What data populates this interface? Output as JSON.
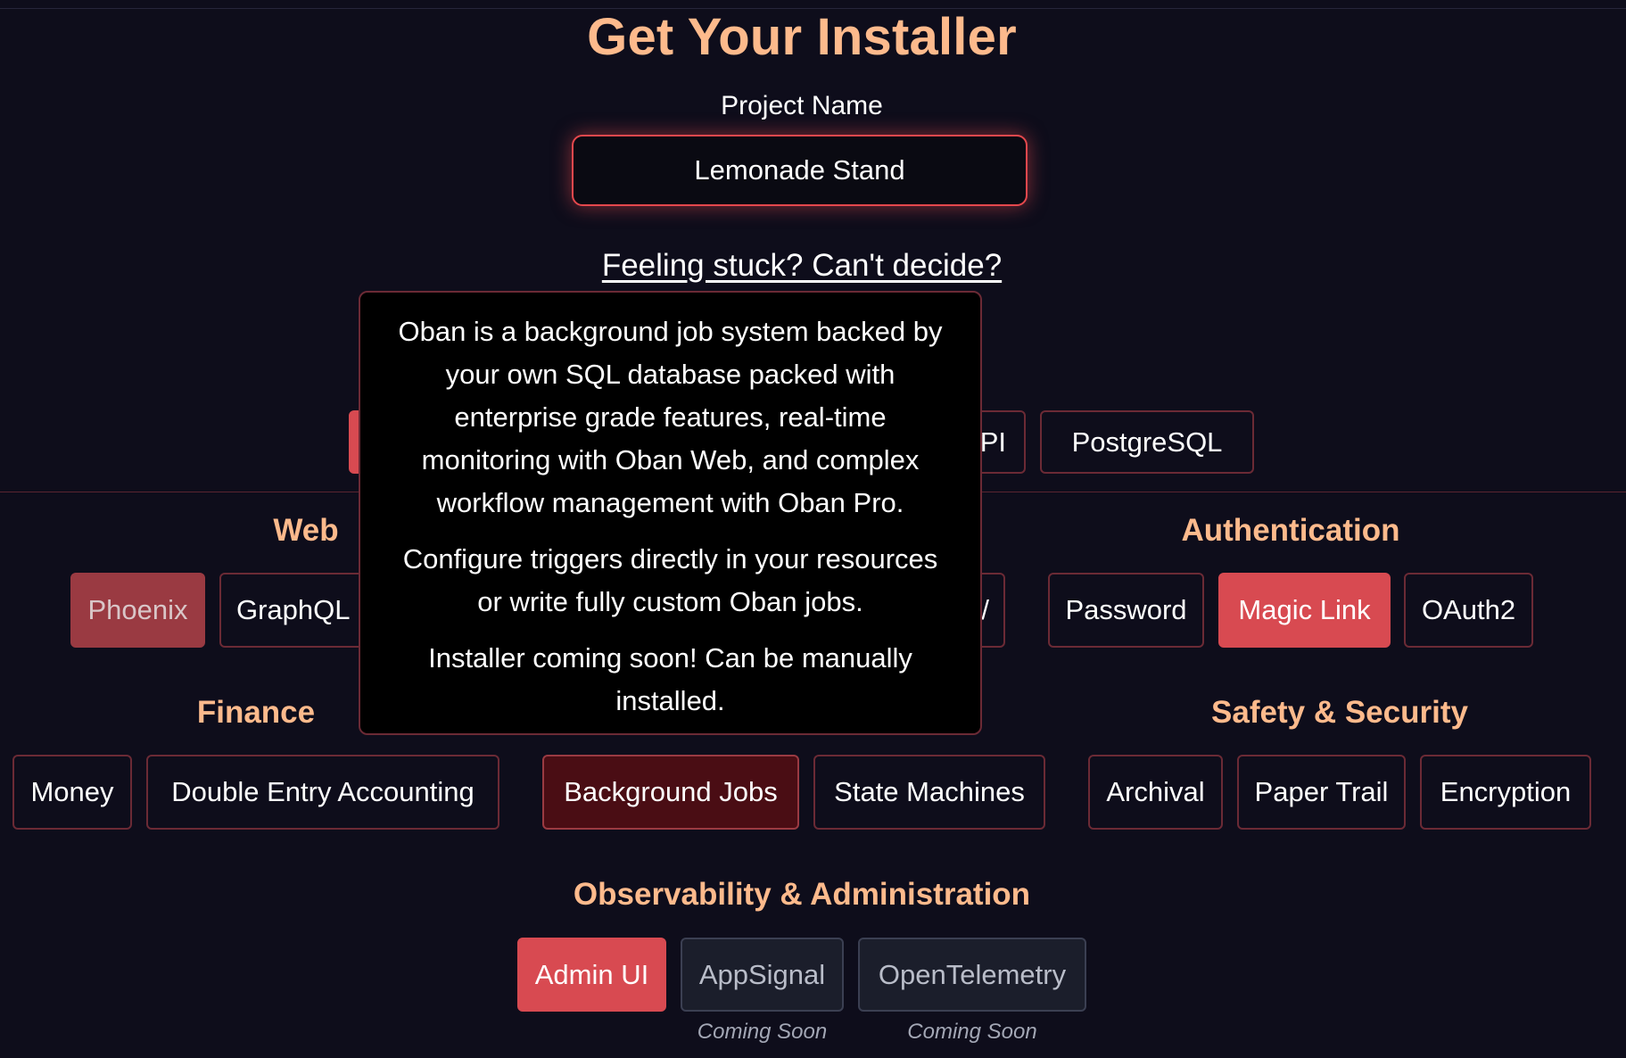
{
  "header": {
    "title": "Get Your Installer",
    "project_label": "Project Name",
    "project_value": "Lemonade Stand",
    "help_link": "Feeling stuck? Can't decide?"
  },
  "top_row": {
    "partial_chip_fragment": "PI",
    "postgres": "PostgreSQL"
  },
  "sections": {
    "web": {
      "title": "Web",
      "items": [
        "Phoenix",
        "GraphQL"
      ],
      "hidden_fragment": "/"
    },
    "authentication": {
      "title": "Authentication",
      "items": [
        "Password",
        "Magic Link",
        "OAuth2"
      ]
    },
    "finance": {
      "title": "Finance",
      "items": [
        "Money",
        "Double Entry Accounting"
      ]
    },
    "automation": {
      "items": [
        "Background Jobs",
        "State Machines"
      ]
    },
    "safety": {
      "title": "Safety & Security",
      "items": [
        "Archival",
        "Paper Trail",
        "Encryption"
      ]
    },
    "observability": {
      "title": "Observability & Administration",
      "items": [
        "Admin UI",
        "AppSignal",
        "OpenTelemetry"
      ],
      "coming_soon": "Coming Soon"
    }
  },
  "tooltip": {
    "para1": "Oban is a background job system backed by your own SQL database packed with enterprise grade features, real-time monitoring with Oban Web, and complex workflow management with Oban Pro.",
    "para2": "Configure triggers directly in your resources or write fully custom Oban jobs.",
    "para3": "Installer coming soon! Can be manually installed."
  },
  "colors": {
    "background": "#0e0d1b",
    "accent": "#fdba8c",
    "selected": "#d84a51",
    "border": "#6b2a35"
  }
}
